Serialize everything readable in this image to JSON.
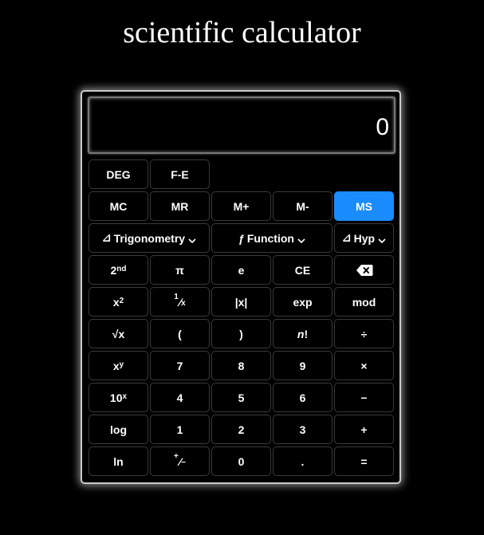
{
  "title": "scientific calculator",
  "display": {
    "value": "0"
  },
  "buttons": {
    "deg": "DEG",
    "fe": "F-E",
    "mc": "MC",
    "mr": "MR",
    "mplus": "M+",
    "mminus": "M-",
    "ms": "MS",
    "trigonometry": "Trigonometry",
    "function": "Function",
    "hyp": "Hyp",
    "second_base": "2",
    "second_sup": "nd",
    "pi": "π",
    "e": "e",
    "ce": "CE",
    "square_base": "x",
    "square_sup": "2",
    "recip_num": "1",
    "recip_den": "x",
    "abs": "|x|",
    "exp": "exp",
    "mod": "mod",
    "sqrt_sym": "√",
    "sqrt_x": "x",
    "lparen": "(",
    "rparen": ")",
    "factorial_n": "n",
    "factorial_bang": "!",
    "divide": "÷",
    "power_base": "x",
    "power_sup": "y",
    "seven": "7",
    "eight": "8",
    "nine": "9",
    "multiply": "×",
    "tenpow_base": "10",
    "tenpow_sup": "x",
    "four": "4",
    "five": "5",
    "six": "6",
    "minus": "−",
    "log": "log",
    "one": "1",
    "two": "2",
    "three": "3",
    "plus": "+",
    "ln": "ln",
    "negate_plus": "+",
    "negate_minus": "−",
    "zero": "0",
    "dot": ".",
    "equals": "="
  },
  "icons": {
    "triangle": "⊿",
    "function": "ƒ"
  },
  "colors": {
    "accent": "#1a8cff",
    "background": "#000000"
  }
}
